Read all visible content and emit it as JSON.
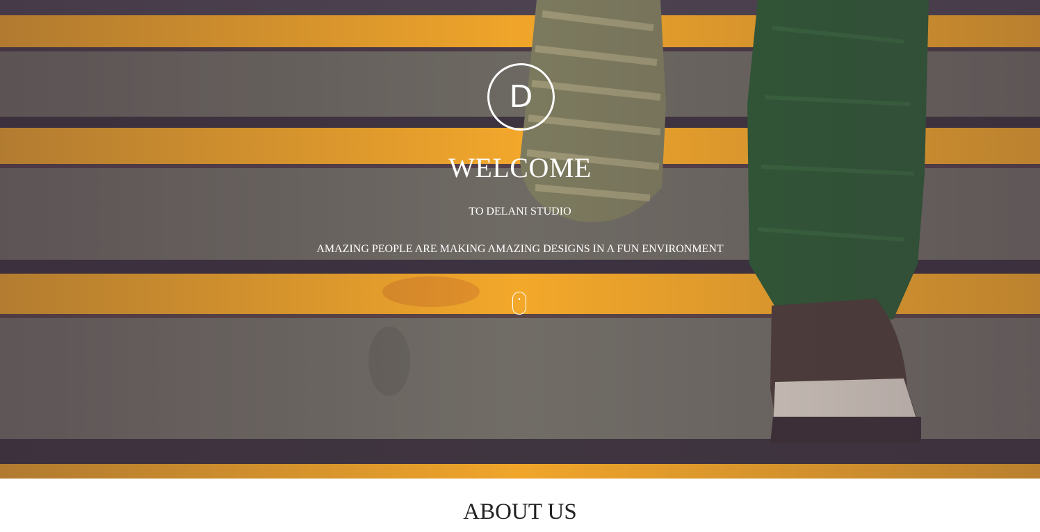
{
  "hero": {
    "logo_letter": "D",
    "title": "WELCOME",
    "subtitle": "TO DELANI STUDIO",
    "tagline": "AMAZING PEOPLE ARE MAKING AMAZING DESIGNS IN A FUN ENVIRONMENT",
    "scroll_icon": "mouse-scroll-icon",
    "background_icon": "staircase-photo"
  },
  "about": {
    "heading": "ABOUT US"
  },
  "colors": {
    "stripe_yellow": "#f0a52a",
    "step_gray": "#706b63",
    "text_white": "#ffffff",
    "heading_dark": "#222222"
  }
}
